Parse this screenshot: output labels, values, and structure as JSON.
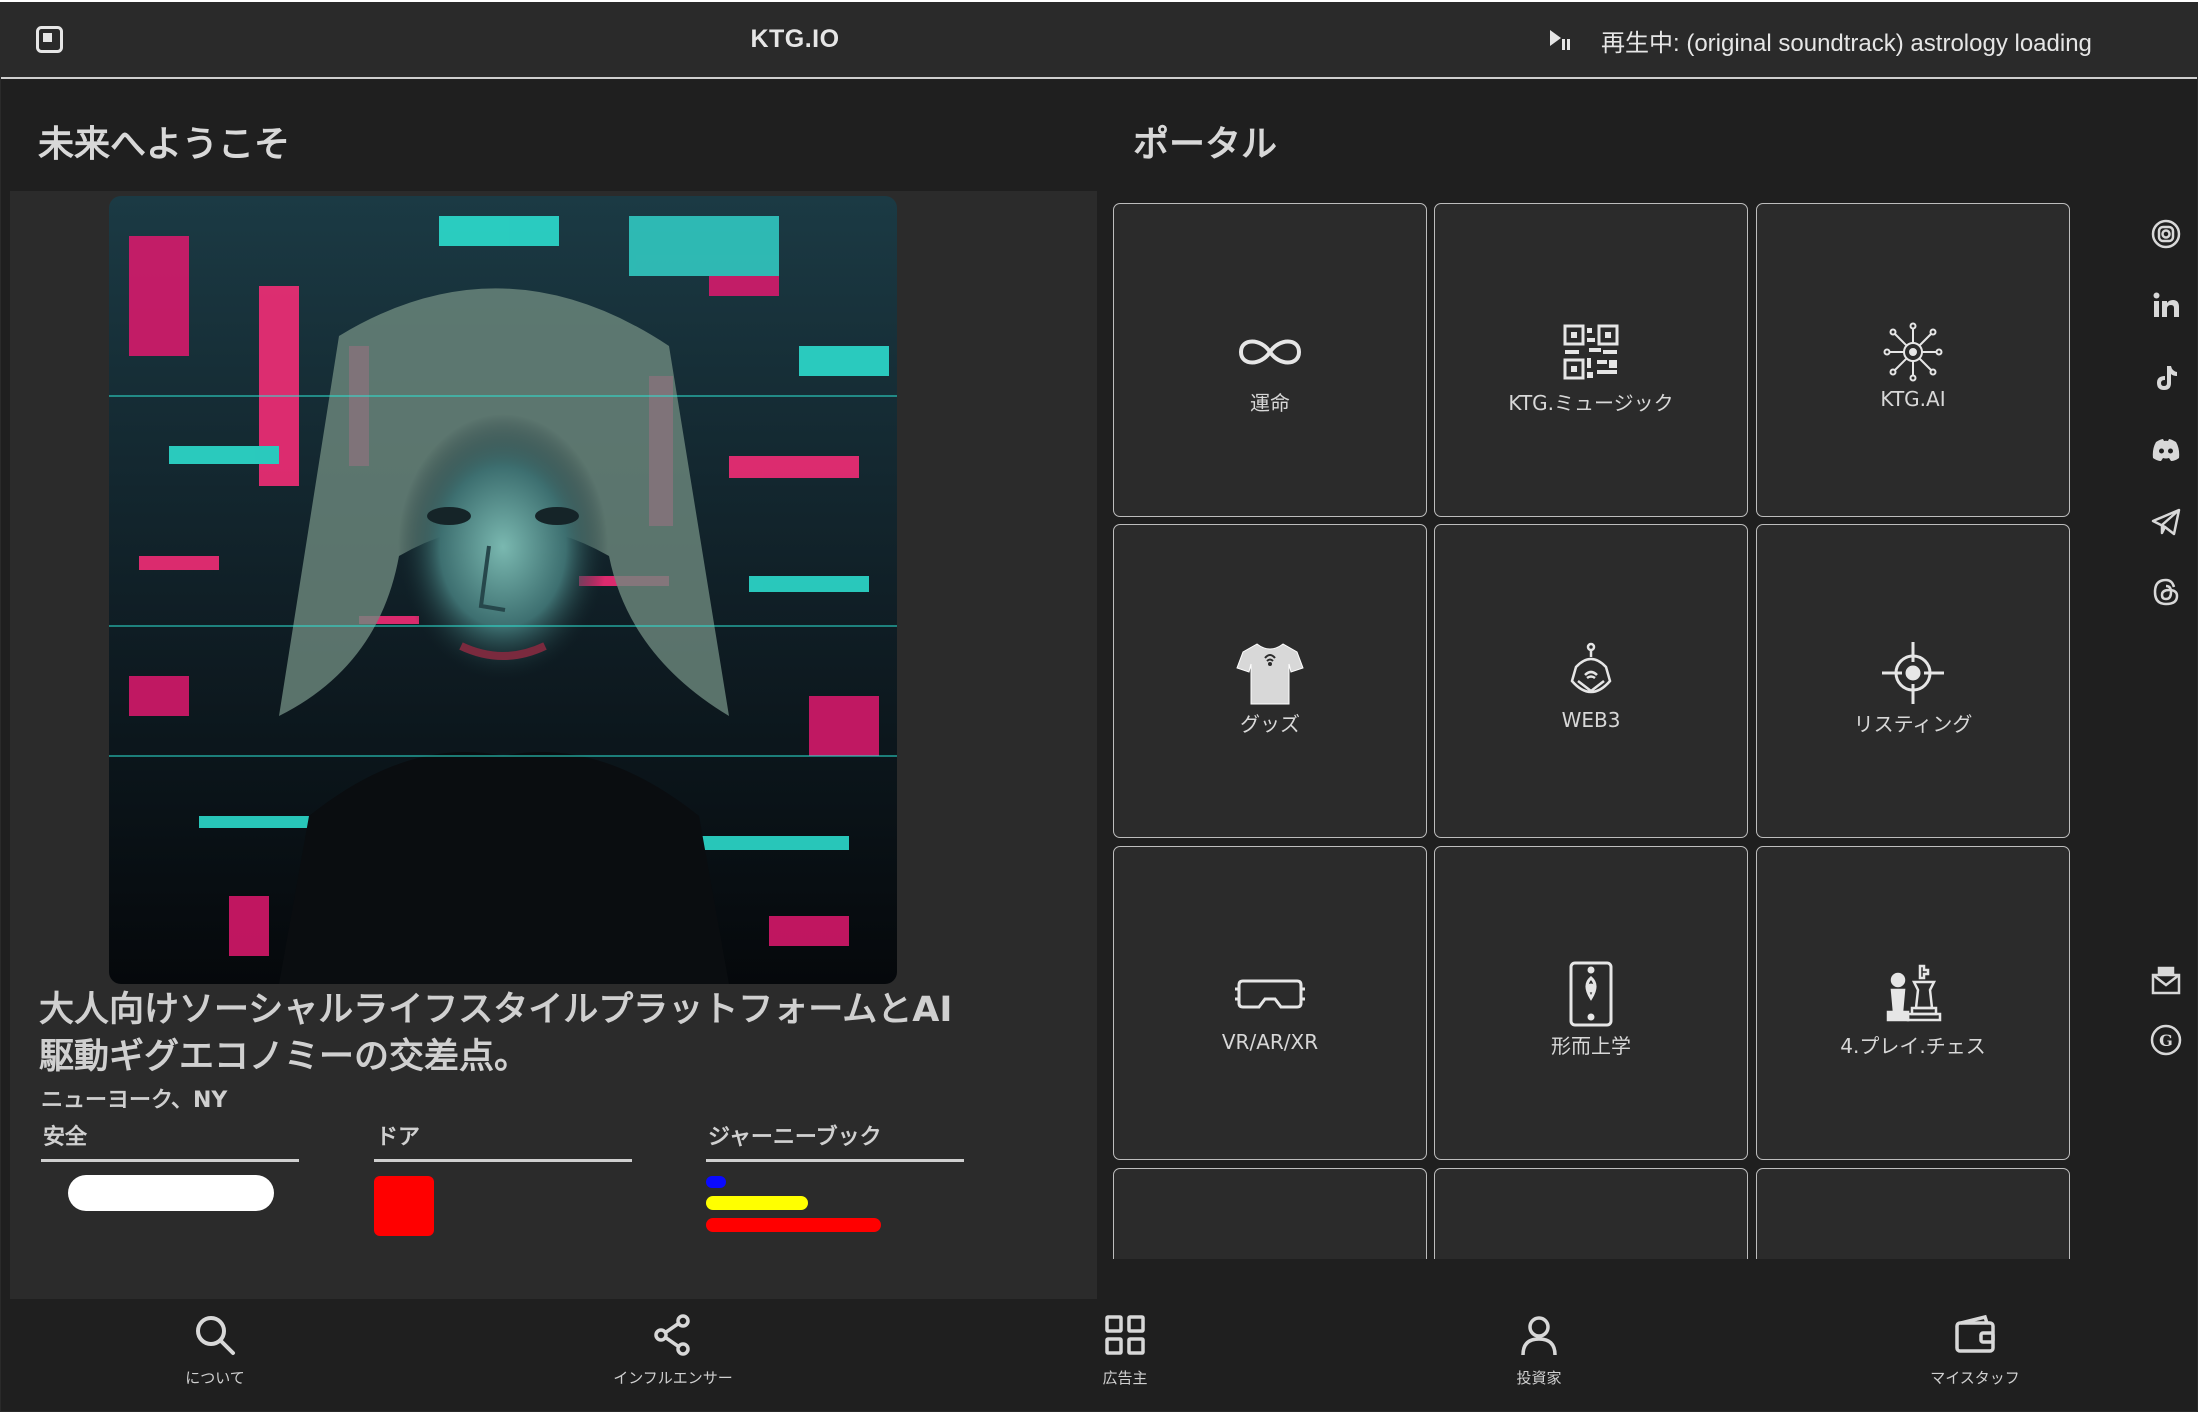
{
  "header": {
    "title": "KTG.IO",
    "now_playing": "再生中: (original soundtrack) astrology loading",
    "icons": [
      "menu-square-icon",
      "play-pause-icon"
    ]
  },
  "left": {
    "heading": "未来へようこそ",
    "headline_line1": "大人向けソーシャルライフスタイルプラットフォームとAI",
    "headline_line2": "駆動ギグエコノミーの交差点。",
    "location": "ニューヨーク、NY",
    "stats": {
      "safety": "安全",
      "door": "ドア",
      "journey": "ジャーニーブック"
    },
    "colors": {
      "pill": "#ffffff",
      "door": "#ff0000",
      "journey": [
        "#0a0aff",
        "#ffff00",
        "#ff0000"
      ]
    }
  },
  "portal": {
    "heading": "ポータル",
    "tiles": [
      {
        "label": "運命",
        "icon": "infinity-icon"
      },
      {
        "label": "KTG.ミュージック",
        "icon": "qr-code-icon"
      },
      {
        "label": "KTG.AI",
        "icon": "neural-network-icon"
      },
      {
        "label": "グッズ",
        "icon": "tshirt-icon"
      },
      {
        "label": "WEB3",
        "icon": "web3-badge-icon"
      },
      {
        "label": "リスティング",
        "icon": "crosshair-icon"
      },
      {
        "label": "VR/AR/XR",
        "icon": "vr-headset-icon"
      },
      {
        "label": "形而上学",
        "icon": "tarot-card-icon"
      },
      {
        "label": "4.プレイ.チェス",
        "icon": "chess-icon"
      }
    ]
  },
  "social": [
    "instagram-icon",
    "linkedin-icon",
    "tiktok-icon",
    "discord-icon",
    "telegram-icon",
    "threads-icon",
    "mail-icon",
    "g-coin-icon"
  ],
  "bottom_nav": [
    {
      "label": "について",
      "icon": "search-icon"
    },
    {
      "label": "インフルエンサー",
      "icon": "share-icon"
    },
    {
      "label": "広告主",
      "icon": "grid-icon"
    },
    {
      "label": "投資家",
      "icon": "user-icon"
    },
    {
      "label": "マイスタッフ",
      "icon": "wallet-icon"
    }
  ]
}
